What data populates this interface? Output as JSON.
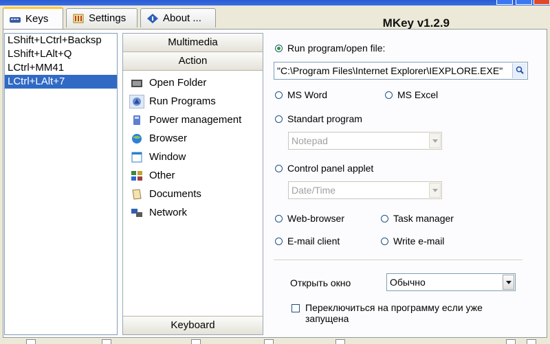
{
  "app": {
    "title": "MKey v1.2.9"
  },
  "tabs": [
    {
      "label": "Keys",
      "icon": "keyboard-icon"
    },
    {
      "label": "Settings",
      "icon": "settings-icon"
    },
    {
      "label": "About ...",
      "icon": "about-icon"
    }
  ],
  "keys": [
    "LShift+LCtrl+Backsp",
    "LShift+LAlt+Q",
    "LCtrl+MM41",
    "LCtrl+LAlt+7"
  ],
  "categories": {
    "headers": [
      "Multimedia",
      "Action"
    ],
    "items": [
      {
        "label": "Open Folder",
        "icon": "folder-icon"
      },
      {
        "label": "Run Programs",
        "icon": "run-programs-icon"
      },
      {
        "label": "Power management",
        "icon": "power-icon"
      },
      {
        "label": "Browser",
        "icon": "browser-icon"
      },
      {
        "label": "Window",
        "icon": "window-icon"
      },
      {
        "label": "Other",
        "icon": "other-icon"
      },
      {
        "label": "Documents",
        "icon": "documents-icon"
      },
      {
        "label": "Network",
        "icon": "network-icon"
      }
    ],
    "footer": "Keyboard"
  },
  "settings": {
    "run_program_label": "Run program/open file:",
    "path_value": "\"C:\\Program Files\\Internet Explorer\\IEXPLORE.EXE\"",
    "ms_word": "MS Word",
    "ms_excel": "MS Excel",
    "standart_program": "Standart program",
    "standart_combo": "Notepad",
    "control_panel": "Control panel applet",
    "control_combo": "Date/Time",
    "web_browser": "Web-browser",
    "task_manager": "Task manager",
    "email_client": "E-mail client",
    "write_email": "Write e-mail",
    "open_window_label": "Открыть окно",
    "open_window_value": "Обычно",
    "switch_label": "Переключиться на программу если уже запущена"
  }
}
